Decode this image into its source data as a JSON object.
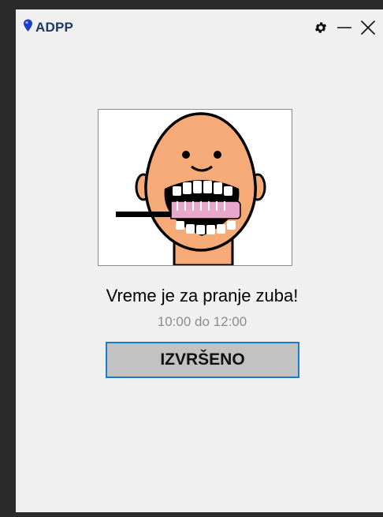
{
  "window": {
    "app_name": "ADPP",
    "icons": {
      "logo": "map-pin-icon",
      "settings": "gear-icon",
      "minimize": "minimize-icon",
      "close": "close-icon"
    }
  },
  "task": {
    "image": "tooth-brushing-pictogram",
    "message": "Vreme je za pranje zuba!",
    "time_range": "10:00 do 12:00",
    "done_label": "IZVRŠENO"
  },
  "colors": {
    "window_bg": "#f0f0f0",
    "title_text": "#1e3a64",
    "button_bg": "#c2c2c2",
    "button_border": "#1a7bd1",
    "time_text": "#8c8c8c"
  }
}
